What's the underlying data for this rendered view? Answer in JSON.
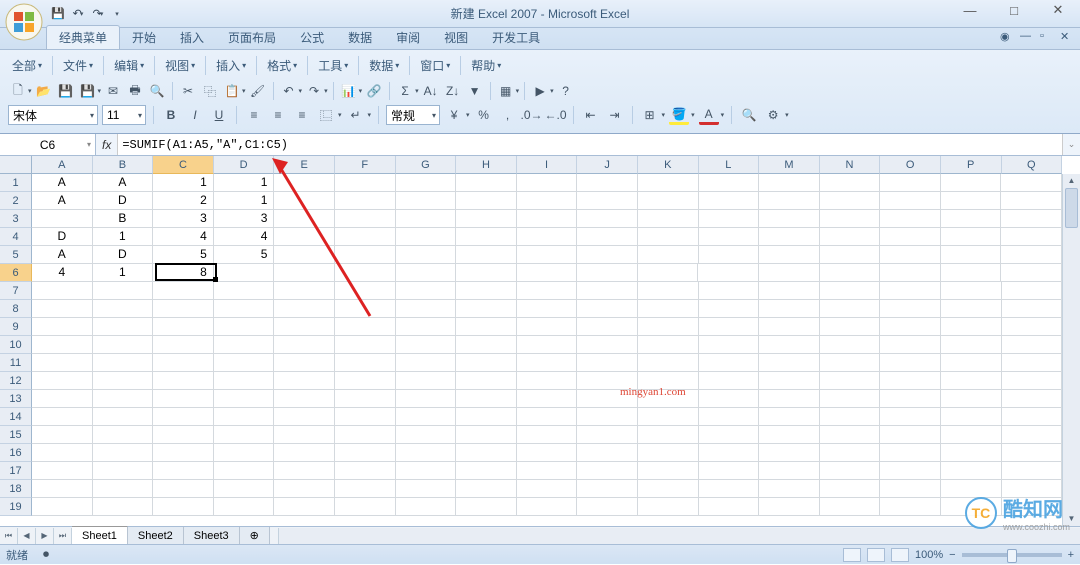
{
  "title": "新建 Excel 2007 - Microsoft Excel",
  "ribbon": {
    "tabs": [
      "经典菜单",
      "开始",
      "插入",
      "页面布局",
      "公式",
      "数据",
      "审阅",
      "视图",
      "开发工具"
    ],
    "active": 0,
    "menus": [
      "全部",
      "文件",
      "编辑",
      "视图",
      "插入",
      "格式",
      "工具",
      "数据",
      "窗口",
      "帮助"
    ]
  },
  "font": {
    "name": "宋体",
    "size": "11",
    "format": "常规"
  },
  "name_box": "C6",
  "formula": "=SUMIF(A1:A5,\"A\",C1:C5)",
  "columns": [
    "A",
    "B",
    "C",
    "D",
    "E",
    "F",
    "G",
    "H",
    "I",
    "J",
    "K",
    "L",
    "M",
    "N",
    "O",
    "P",
    "Q"
  ],
  "sel_col_index": 2,
  "rows_shown": 19,
  "sel_row_index": 5,
  "cells": {
    "1": {
      "A": "A",
      "B": "A",
      "C": "1",
      "D": "1"
    },
    "2": {
      "A": "A",
      "B": "D",
      "C": "2",
      "D": "1"
    },
    "3": {
      "A": "",
      "B": "B",
      "C": "3",
      "D": "3"
    },
    "4": {
      "A": "D",
      "B": "1",
      "C": "4",
      "D": "4"
    },
    "5": {
      "A": "A",
      "B": "D",
      "C": "5",
      "D": "5"
    },
    "6": {
      "A": "4",
      "B": "1",
      "C": "8",
      "D": ""
    }
  },
  "active_cell": {
    "col": 2,
    "row": 5
  },
  "sheets": [
    "Sheet1",
    "Sheet2",
    "Sheet3"
  ],
  "active_sheet": 0,
  "status": "就绪",
  "zoom": "100%",
  "watermark": "mingyan1.com",
  "logo": {
    "text": "酷知网",
    "sub": "www.coozhi.com",
    "badge": "TC"
  }
}
